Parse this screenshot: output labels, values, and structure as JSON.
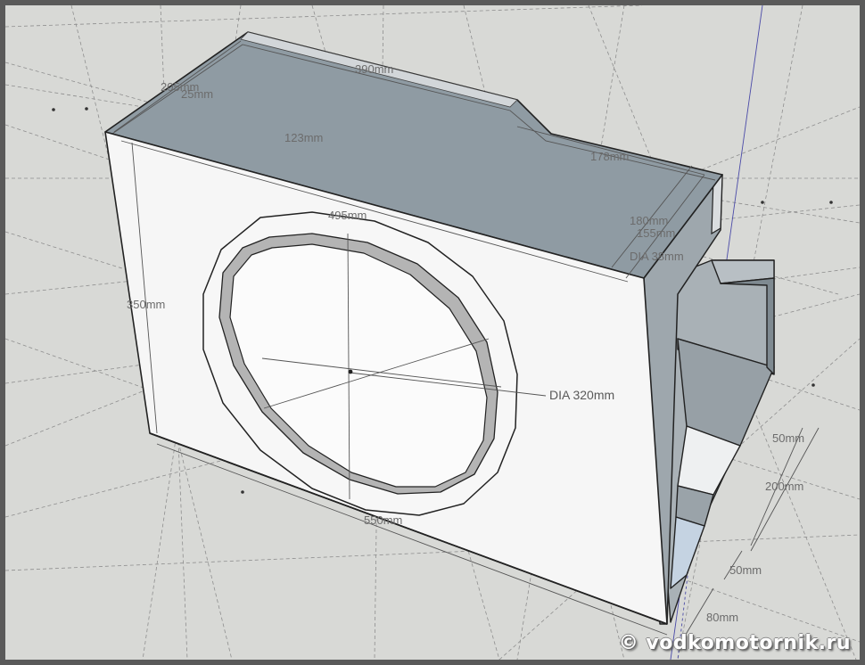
{
  "dimensions": {
    "top_depth_a": "205mm",
    "top_depth_b": "25mm",
    "top_width": "390mm",
    "port_offset": "123mm",
    "port_length": "178mm",
    "front_width": "495mm",
    "side_a": "180mm",
    "side_b": "155mm",
    "port_dia": "DIA 38mm",
    "height": "350mm",
    "woofer_dia": "DIA 320mm",
    "bottom_width": "550mm",
    "right_a": "50mm",
    "right_b": "200mm",
    "right_c": "50mm",
    "right_d": "80mm"
  },
  "watermark": "© vodkomotornik.ru",
  "colors": {
    "background": "#d8d9d6",
    "top_face": "#8f9ba3",
    "front_face": "#f6f6f6",
    "edge": "#222222"
  }
}
